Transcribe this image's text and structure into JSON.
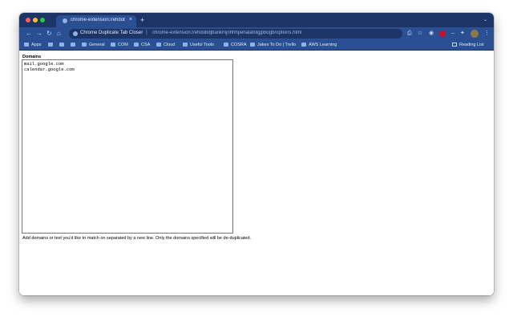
{
  "tab": {
    "title": "chrome-extension://ehdob...",
    "close_label": "×"
  },
  "tabstrip": {
    "new_tab_label": "+",
    "menu_label": "⌄"
  },
  "toolbar": {
    "back": "←",
    "forward": "→",
    "reload": "↻",
    "home": "⌂",
    "site_name": "Chrome Duplicate Tab Closer",
    "separator": "|",
    "url": "chrome-extension://ehdobdjbankmjnhhhpehalafolgjpbogb/options.html",
    "lock": "⎙",
    "star": "☆",
    "ext1": "◉",
    "ext_sep": "–",
    "puzzle": "✦",
    "menu": "⋮"
  },
  "bookmarks": {
    "items": [
      {
        "label": "Apps"
      },
      {
        "label": ""
      },
      {
        "label": ""
      },
      {
        "label": ""
      },
      {
        "label": "General"
      },
      {
        "label": "COM"
      },
      {
        "label": "CSA"
      },
      {
        "label": "Cloud"
      },
      {
        "label": "Useful Tools"
      },
      {
        "label": "COSRA"
      },
      {
        "label": "Jakes To Do | Trello"
      },
      {
        "label": "AWS Learning"
      }
    ],
    "reading_list": "Reading List"
  },
  "options": {
    "domains_label": "Domains",
    "domains_value": "mail.google.com\ncalendar.google.com",
    "hint": "Add domains or text you'd like to match on separated by a new line. Only the domains specified will be de-duplicated."
  },
  "colors": {
    "tabstrip": "#1c3566",
    "toolbar": "#2b4f93"
  }
}
